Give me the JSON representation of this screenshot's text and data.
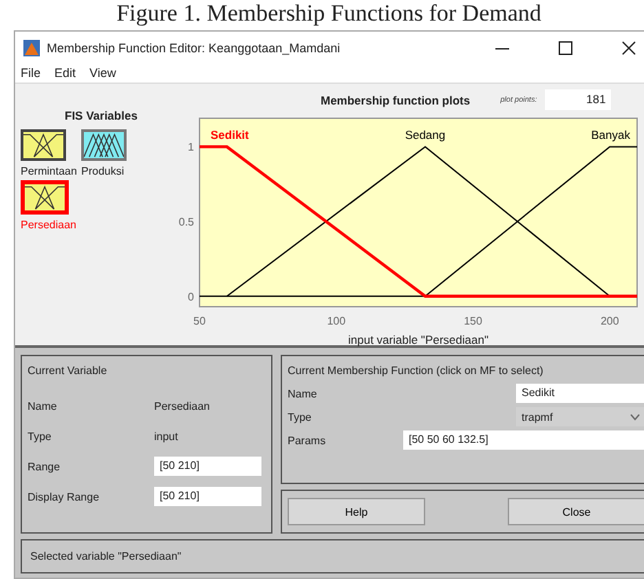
{
  "caption": "Figure 1. Membership Functions for Demand",
  "window": {
    "title": "Membership Function Editor: Keanggotaan_Mamdani"
  },
  "menu": [
    "File",
    "Edit",
    "View"
  ],
  "fis_variables": {
    "title": "FIS Variables",
    "items": [
      {
        "label": "Permintaan",
        "kind": "input",
        "selected": false
      },
      {
        "label": "Produksi",
        "kind": "output",
        "selected": false
      },
      {
        "label": "Persediaan",
        "kind": "input",
        "selected": true
      }
    ]
  },
  "plot": {
    "title": "Membership function plots",
    "points_label": "plot points:",
    "points_value": "181",
    "chart_data": {
      "type": "line",
      "xlabel": "input variable \"Persediaan\"",
      "x": [
        50,
        60,
        132.5,
        200,
        210
      ],
      "xlim": [
        50,
        210
      ],
      "ylim": [
        -0.07,
        1.19
      ],
      "xticks": [
        50,
        100,
        150,
        200
      ],
      "yticks": [
        0,
        0.5,
        1
      ],
      "series": [
        {
          "name": "Sedikit",
          "color": "#ff0000",
          "values": [
            1,
            1,
            0,
            0,
            0
          ]
        },
        {
          "name": "Sedang",
          "color": "#000000",
          "values": [
            null,
            0,
            1,
            0,
            null
          ]
        },
        {
          "name": "Banyak",
          "color": "#000000",
          "values": [
            null,
            null,
            0,
            1,
            1
          ]
        }
      ]
    }
  },
  "current_variable": {
    "title": "Current Variable",
    "fields": [
      {
        "label": "Name",
        "value": "Persediaan",
        "kind": "text"
      },
      {
        "label": "Type",
        "value": "input",
        "kind": "text"
      },
      {
        "label": "Range",
        "value": "[50 210]",
        "kind": "input"
      },
      {
        "label": "Display Range",
        "value": "[50 210]",
        "kind": "input"
      }
    ]
  },
  "current_mf": {
    "title": "Current Membership Function (click on MF to select)",
    "fields": [
      {
        "label": "Name",
        "value": "Sedikit",
        "kind": "input"
      },
      {
        "label": "Type",
        "value": "trapmf",
        "kind": "select"
      },
      {
        "label": "Params",
        "value": "[50 50 60 132.5]",
        "kind": "wide"
      }
    ]
  },
  "buttons": [
    "Help",
    "Close"
  ],
  "status": "Selected variable \"Persediaan\""
}
